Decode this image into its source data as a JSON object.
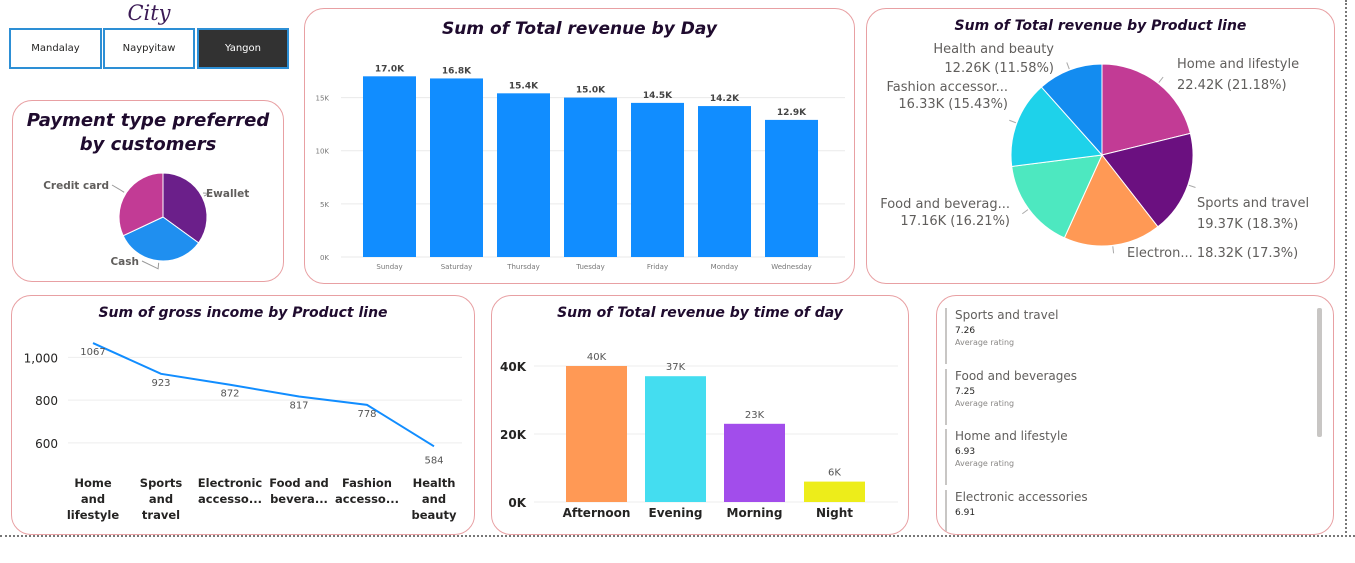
{
  "slicer": {
    "title": "City",
    "options": [
      "Mandalay",
      "Naypyitaw",
      "Yangon"
    ],
    "selected": "Yangon"
  },
  "payment": {
    "title": "Payment type preferred by customers",
    "labels": [
      "Ewallet",
      "Cash",
      "Credit card"
    ],
    "colors": [
      "#6b1f8a",
      "#1f8ff0",
      "#c23b95"
    ]
  },
  "revenue_by_day": {
    "title": "Sum of Total revenue by Day",
    "y_ticks": [
      "0K",
      "5K",
      "10K",
      "15K"
    ],
    "data_labels": [
      "17.0K",
      "16.8K",
      "15.4K",
      "15.0K",
      "14.5K",
      "14.2K",
      "12.9K"
    ],
    "color": "#118dff"
  },
  "revenue_by_product": {
    "title": "Sum of Total revenue by Product line",
    "slice_labels": [
      {
        "name": "Home and lifestyle",
        "value": "22.42K (21.18%)"
      },
      {
        "name": "Sports and travel",
        "value": "19.37K (18.3%)"
      },
      {
        "name": "Electron...",
        "value": "18.32K (17.3%)"
      },
      {
        "name": "Food and beverag...",
        "value": "17.16K (16.21%)"
      },
      {
        "name": "Fashion accessor...",
        "value": "16.33K (15.43%)"
      },
      {
        "name": "Health and beauty",
        "value": "12.26K (11.58%)"
      }
    ],
    "colors": [
      "#c23b95",
      "#6b1080",
      "#ff9955",
      "#4de8c0",
      "#1ed2ea",
      "#138cf0"
    ]
  },
  "gross_income": {
    "title": "Sum of gross income by Product line",
    "y_ticks": [
      "600",
      "800",
      "1,000"
    ],
    "categories": [
      [
        "Home",
        "and",
        "lifestyle"
      ],
      [
        "Sports",
        "and",
        "travel"
      ],
      [
        "Electronic",
        "accesso..."
      ],
      [
        "Food and",
        "bevera..."
      ],
      [
        "Fashion",
        "accesso..."
      ],
      [
        "Health",
        "and",
        "beauty"
      ]
    ],
    "color": "#118dff"
  },
  "revenue_by_time": {
    "title": "Sum of Total revenue by time of day",
    "y_ticks": [
      "0K",
      "20K",
      "40K"
    ],
    "data_labels": [
      "40K",
      "37K",
      "23K",
      "6K"
    ]
  },
  "ratings": {
    "items": [
      {
        "name": "Sports and travel",
        "value": "7.26",
        "sub": "Average rating"
      },
      {
        "name": "Food and beverages",
        "value": "7.25",
        "sub": "Average rating"
      },
      {
        "name": "Home and lifestyle",
        "value": "6.93",
        "sub": "Average rating"
      },
      {
        "name": "Electronic accessories",
        "value": "6.91",
        "sub": "Average rating"
      }
    ]
  },
  "chart_data": [
    {
      "type": "pie",
      "title": "Payment type preferred by customers",
      "labels": [
        "Ewallet",
        "Cash",
        "Credit card"
      ],
      "values": [
        0.35,
        0.33,
        0.32
      ]
    },
    {
      "type": "bar",
      "title": "Sum of Total revenue by Day",
      "categories": [
        "Sunday",
        "Saturday",
        "Thursday",
        "Tuesday",
        "Friday",
        "Monday",
        "Wednesday"
      ],
      "values": [
        17.0,
        16.8,
        15.4,
        15.0,
        14.5,
        14.2,
        12.9
      ],
      "ylim": [
        0,
        17.5
      ],
      "grid": true
    },
    {
      "type": "pie",
      "title": "Sum of Total revenue by Product line",
      "labels": [
        "Home and lifestyle",
        "Sports and travel",
        "Electronic accessories",
        "Food and beverages",
        "Fashion accessories",
        "Health and beauty"
      ],
      "values": [
        22.42,
        19.37,
        18.32,
        17.16,
        16.33,
        12.26
      ],
      "percents": [
        21.18,
        18.3,
        17.3,
        16.21,
        15.43,
        11.58
      ]
    },
    {
      "type": "line",
      "title": "Sum of gross income by Product line",
      "categories": [
        "Home and lifestyle",
        "Sports and travel",
        "Electronic accessories",
        "Food and beverages",
        "Fashion accessories",
        "Health and beauty"
      ],
      "values": [
        1067,
        923,
        872,
        817,
        778,
        584
      ],
      "ylim": [
        520,
        1100
      ],
      "grid": true
    },
    {
      "type": "bar",
      "title": "Sum of Total revenue by time of day",
      "categories": [
        "Afternoon",
        "Evening",
        "Morning",
        "Night"
      ],
      "values": [
        40,
        37,
        23,
        6
      ],
      "colors": [
        "#ff9955",
        "#44ddf0",
        "#a24deb",
        "#eded1a"
      ],
      "ylim": [
        0,
        46
      ],
      "grid": true
    }
  ]
}
